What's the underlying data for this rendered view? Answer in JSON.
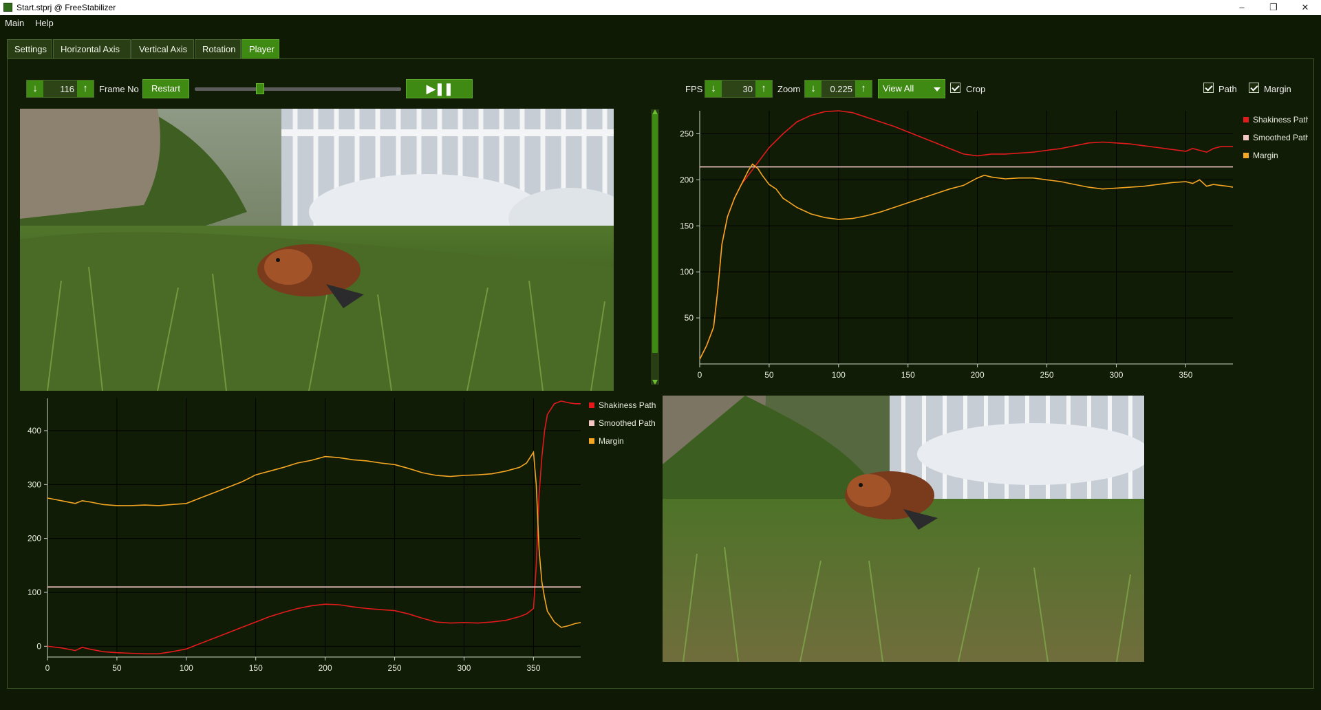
{
  "window": {
    "title": "Start.stprj @ FreeStabilizer",
    "min": "–",
    "max": "❐",
    "close": "✕"
  },
  "menu": [
    {
      "label": "Main"
    },
    {
      "label": "Help"
    }
  ],
  "tabs": [
    {
      "label": "Settings",
      "active": false
    },
    {
      "label": "Horizontal Axis",
      "active": false
    },
    {
      "label": "Vertical Axis",
      "active": false
    },
    {
      "label": "Rotation",
      "active": false
    },
    {
      "label": "Player",
      "active": true
    }
  ],
  "player": {
    "frame_value": "116",
    "frame_label": "Frame No",
    "restart_label": "Restart",
    "play_pause_glyph": "▶❚❚",
    "frame_progress": 0.31,
    "fps_label": "FPS",
    "fps_value": "30",
    "zoom_label": "Zoom",
    "zoom_value": "0.225",
    "view_option": "View All",
    "crop_label": "Crop",
    "crop_checked": true,
    "path_label": "Path",
    "path_checked": true,
    "margin_label": "Margin",
    "margin_checked": true,
    "vertical_level": 0.9
  },
  "colors": {
    "shakiness": "#e31a1c",
    "smoothed": "#f4c7c7",
    "margin": "#f5a623",
    "grid": "#000000",
    "plot_bg": "#111c06",
    "accent": "#3f8a12"
  },
  "chart_data": [
    {
      "type": "line",
      "title": "",
      "xlabel": "",
      "ylabel": "",
      "xlim": [
        0,
        384
      ],
      "ylim": [
        0,
        275
      ],
      "xticks": [
        0,
        50,
        100,
        150,
        200,
        250,
        300,
        350
      ],
      "yticks": [
        50,
        100,
        150,
        200,
        250
      ],
      "legend": "top-right",
      "series": [
        {
          "name": "Shakiness Path",
          "x": [
            0,
            5,
            10,
            13,
            16,
            20,
            25,
            30,
            35,
            40,
            45,
            50,
            60,
            70,
            80,
            90,
            100,
            110,
            120,
            130,
            140,
            150,
            160,
            170,
            180,
            190,
            200,
            210,
            220,
            230,
            240,
            250,
            260,
            270,
            280,
            290,
            300,
            310,
            320,
            330,
            340,
            350,
            355,
            360,
            365,
            370,
            375,
            380,
            384
          ],
          "y": [
            5,
            20,
            40,
            80,
            130,
            160,
            180,
            195,
            205,
            215,
            225,
            235,
            250,
            263,
            270,
            274,
            275,
            273,
            268,
            263,
            258,
            252,
            246,
            240,
            234,
            228,
            226,
            228,
            228,
            229,
            230,
            232,
            234,
            237,
            240,
            241,
            240,
            239,
            237,
            235,
            233,
            231,
            234,
            232,
            230,
            234,
            236,
            236,
            236
          ]
        },
        {
          "name": "Smoothed Path",
          "x": [
            0,
            384
          ],
          "y": [
            214,
            214
          ]
        },
        {
          "name": "Margin",
          "x": [
            0,
            5,
            10,
            13,
            16,
            20,
            25,
            30,
            35,
            38,
            42,
            45,
            50,
            55,
            60,
            70,
            80,
            90,
            100,
            110,
            120,
            130,
            140,
            150,
            160,
            170,
            180,
            190,
            200,
            205,
            210,
            220,
            230,
            240,
            250,
            260,
            270,
            280,
            290,
            300,
            310,
            320,
            330,
            340,
            350,
            355,
            360,
            365,
            370,
            375,
            380,
            384
          ],
          "y": [
            5,
            20,
            40,
            80,
            130,
            160,
            180,
            195,
            210,
            217,
            212,
            205,
            195,
            190,
            180,
            170,
            163,
            159,
            157,
            158,
            161,
            165,
            170,
            175,
            180,
            185,
            190,
            194,
            202,
            205,
            203,
            201,
            202,
            202,
            200,
            198,
            195,
            192,
            190,
            191,
            192,
            193,
            195,
            197,
            198,
            196,
            200,
            193,
            195,
            194,
            193,
            192
          ]
        }
      ]
    },
    {
      "type": "line",
      "title": "",
      "xlabel": "",
      "ylabel": "",
      "xlim": [
        0,
        384
      ],
      "ylim": [
        -20,
        460
      ],
      "xticks": [
        0,
        50,
        100,
        150,
        200,
        250,
        300,
        350
      ],
      "yticks": [
        0,
        100,
        200,
        300,
        400
      ],
      "legend": "top-right",
      "series": [
        {
          "name": "Shakiness Path",
          "x": [
            0,
            10,
            20,
            25,
            30,
            40,
            50,
            60,
            70,
            80,
            90,
            100,
            110,
            120,
            130,
            140,
            150,
            160,
            170,
            180,
            190,
            200,
            210,
            220,
            230,
            240,
            250,
            260,
            270,
            280,
            290,
            300,
            310,
            320,
            330,
            340,
            345,
            350,
            352,
            354,
            356,
            358,
            360,
            365,
            370,
            375,
            380,
            384
          ],
          "y": [
            0,
            -3,
            -8,
            -2,
            -5,
            -10,
            -12,
            -13,
            -14,
            -14,
            -10,
            -5,
            5,
            15,
            25,
            35,
            45,
            55,
            63,
            70,
            75,
            78,
            77,
            73,
            70,
            68,
            66,
            60,
            52,
            45,
            43,
            44,
            43,
            45,
            48,
            55,
            60,
            70,
            150,
            280,
            350,
            400,
            430,
            450,
            455,
            452,
            450,
            450
          ]
        },
        {
          "name": "Smoothed Path",
          "x": [
            0,
            384
          ],
          "y": [
            110,
            110
          ]
        },
        {
          "name": "Margin",
          "x": [
            0,
            10,
            20,
            25,
            30,
            40,
            50,
            60,
            70,
            80,
            90,
            100,
            110,
            120,
            130,
            140,
            150,
            160,
            170,
            180,
            190,
            200,
            210,
            220,
            230,
            240,
            250,
            260,
            270,
            280,
            290,
            300,
            310,
            320,
            330,
            340,
            345,
            350,
            352,
            354,
            356,
            358,
            360,
            365,
            370,
            375,
            380,
            384
          ],
          "y": [
            275,
            270,
            265,
            270,
            268,
            263,
            261,
            261,
            262,
            261,
            263,
            265,
            275,
            285,
            295,
            305,
            318,
            325,
            332,
            340,
            345,
            352,
            350,
            346,
            344,
            340,
            337,
            330,
            322,
            317,
            315,
            317,
            318,
            320,
            325,
            332,
            340,
            360,
            300,
            180,
            120,
            90,
            65,
            45,
            35,
            38,
            42,
            44
          ]
        }
      ]
    }
  ]
}
